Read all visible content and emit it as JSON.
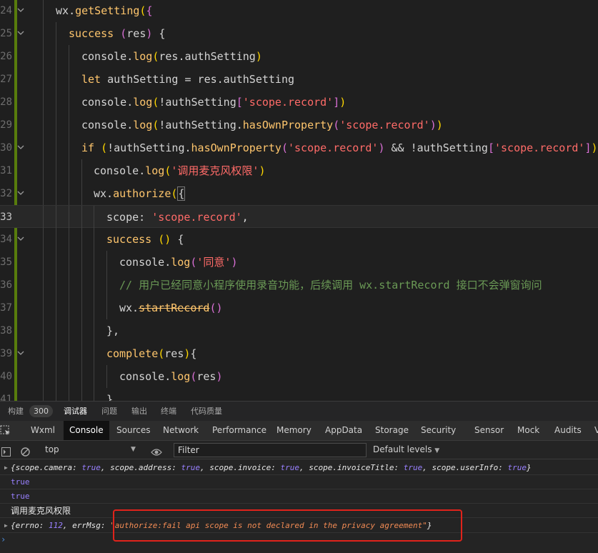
{
  "editor": {
    "lines": [
      {
        "num": "24",
        "indent": 78,
        "fold": true,
        "tokens": [
          [
            "t-obj",
            "wx"
          ],
          [
            "t-plain",
            "."
          ],
          [
            "t-fn",
            "getSetting"
          ],
          [
            "t-par",
            "("
          ],
          [
            "t-brk",
            "{"
          ]
        ]
      },
      {
        "num": "25",
        "indent": 96,
        "fold": true,
        "tokens": [
          [
            "t-kw",
            "success"
          ],
          [
            "t-plain",
            " "
          ],
          [
            "t-brk",
            "("
          ],
          [
            "t-plain",
            "res"
          ],
          [
            "t-brk",
            ")"
          ],
          [
            "t-plain",
            " {"
          ]
        ]
      },
      {
        "num": "26",
        "indent": 114,
        "fold": false,
        "tokens": [
          [
            "t-plain",
            "console."
          ],
          [
            "t-fn",
            "log"
          ],
          [
            "t-par",
            "("
          ],
          [
            "t-plain",
            "res.authSetting"
          ],
          [
            "t-par",
            ")"
          ]
        ]
      },
      {
        "num": "27",
        "indent": 114,
        "fold": false,
        "tokens": [
          [
            "t-kw",
            "let"
          ],
          [
            "t-plain",
            " authSetting = res.authSetting"
          ]
        ]
      },
      {
        "num": "28",
        "indent": 114,
        "fold": false,
        "tokens": [
          [
            "t-plain",
            "console."
          ],
          [
            "t-fn",
            "log"
          ],
          [
            "t-par",
            "("
          ],
          [
            "t-plain",
            "!authSetting"
          ],
          [
            "t-brk",
            "["
          ],
          [
            "t-str",
            "'scope.record'"
          ],
          [
            "t-brk",
            "]"
          ],
          [
            "t-par",
            ")"
          ]
        ]
      },
      {
        "num": "29",
        "indent": 114,
        "fold": false,
        "tokens": [
          [
            "t-plain",
            "console."
          ],
          [
            "t-fn",
            "log"
          ],
          [
            "t-par",
            "("
          ],
          [
            "t-plain",
            "!authSetting."
          ],
          [
            "t-fn",
            "hasOwnProperty"
          ],
          [
            "t-brk",
            "("
          ],
          [
            "t-str",
            "'scope.record'"
          ],
          [
            "t-brk",
            ")"
          ],
          [
            "t-par",
            ")"
          ]
        ]
      },
      {
        "num": "30",
        "indent": 114,
        "fold": true,
        "tokens": [
          [
            "t-kw",
            "if"
          ],
          [
            "t-plain",
            " "
          ],
          [
            "t-par",
            "("
          ],
          [
            "t-plain",
            "!authSetting."
          ],
          [
            "t-fn",
            "hasOwnProperty"
          ],
          [
            "t-brk",
            "("
          ],
          [
            "t-str",
            "'scope.record'"
          ],
          [
            "t-brk",
            ")"
          ],
          [
            "t-plain",
            " && !authSetting"
          ],
          [
            "t-brk",
            "["
          ],
          [
            "t-str",
            "'scope.record'"
          ],
          [
            "t-brk",
            "]"
          ],
          [
            "t-par",
            ")"
          ],
          [
            "t-plain",
            " {"
          ]
        ]
      },
      {
        "num": "31",
        "indent": 131,
        "fold": false,
        "tokens": [
          [
            "t-plain",
            "console."
          ],
          [
            "t-fn",
            "log"
          ],
          [
            "t-par",
            "("
          ],
          [
            "t-str",
            "'调用麦克风权限'"
          ],
          [
            "t-par",
            ")"
          ]
        ]
      },
      {
        "num": "32",
        "indent": 131,
        "fold": true,
        "tokens": [
          [
            "t-plain",
            "wx."
          ],
          [
            "t-fn",
            "authorize"
          ],
          [
            "t-par",
            "("
          ],
          [
            "t-cursor",
            "{"
          ]
        ]
      },
      {
        "num": "33",
        "indent": 149,
        "fold": false,
        "current": true,
        "tokens": [
          [
            "t-plain",
            "scope: "
          ],
          [
            "t-str",
            "'scope.record'"
          ],
          [
            "t-plain",
            ","
          ]
        ]
      },
      {
        "num": "34",
        "indent": 149,
        "fold": true,
        "tokens": [
          [
            "t-kw",
            "success"
          ],
          [
            "t-plain",
            " "
          ],
          [
            "t-par",
            "()"
          ],
          [
            "t-plain",
            " {"
          ]
        ]
      },
      {
        "num": "35",
        "indent": 167,
        "fold": false,
        "tokens": [
          [
            "t-plain",
            "console."
          ],
          [
            "t-fn",
            "log"
          ],
          [
            "t-brk",
            "("
          ],
          [
            "t-str",
            "'同意'"
          ],
          [
            "t-brk",
            ")"
          ]
        ]
      },
      {
        "num": "36",
        "indent": 167,
        "fold": false,
        "tokens": [
          [
            "t-comment",
            "// 用户已经同意小程序使用录音功能，后续调用 wx.startRecord 接口不会弹窗询问"
          ]
        ]
      },
      {
        "num": "37",
        "indent": 167,
        "fold": false,
        "tokens": [
          [
            "t-plain",
            "wx."
          ],
          [
            "t-strike",
            "startRecord"
          ],
          [
            "t-brk",
            "()"
          ]
        ]
      },
      {
        "num": "38",
        "indent": 149,
        "fold": false,
        "tokens": [
          [
            "t-plain",
            "},"
          ]
        ]
      },
      {
        "num": "39",
        "indent": 149,
        "fold": true,
        "tokens": [
          [
            "t-kw",
            "complete"
          ],
          [
            "t-par",
            "("
          ],
          [
            "t-plain",
            "res"
          ],
          [
            "t-par",
            ")"
          ],
          [
            "t-plain",
            "{"
          ]
        ]
      },
      {
        "num": "40",
        "indent": 167,
        "fold": false,
        "tokens": [
          [
            "t-plain",
            "console."
          ],
          [
            "t-fn",
            "log"
          ],
          [
            "t-brk",
            "("
          ],
          [
            "t-plain",
            "res"
          ],
          [
            "t-brk",
            ")"
          ]
        ]
      },
      {
        "num": "41",
        "indent": 149,
        "fold": false,
        "tokens": [
          [
            "t-plain",
            "}"
          ]
        ]
      }
    ]
  },
  "panel_tabs": {
    "build": "构建",
    "build_count": "300",
    "debugger": "调试器",
    "issues": "问题",
    "output": "输出",
    "terminal": "终端",
    "code_quality": "代码质量"
  },
  "devtools_tabs": [
    "Wxml",
    "Console",
    "Sources",
    "Network",
    "Performance",
    "Memory",
    "AppData",
    "Storage",
    "Security",
    "Sensor",
    "Mock",
    "Audits",
    "V"
  ],
  "toolbar": {
    "context": "top",
    "filter_placeholder": "Filter",
    "levels": "Default levels"
  },
  "console": {
    "msg1": {
      "parts": [
        [
          "c-plain",
          "{"
        ],
        [
          "c-key",
          "scope.camera"
        ],
        [
          "c-plain",
          ": "
        ],
        [
          "c-bool",
          "true"
        ],
        [
          "c-plain",
          ", "
        ],
        [
          "c-key",
          "scope.address"
        ],
        [
          "c-plain",
          ": "
        ],
        [
          "c-bool",
          "true"
        ],
        [
          "c-plain",
          ", "
        ],
        [
          "c-key",
          "scope.invoice"
        ],
        [
          "c-plain",
          ": "
        ],
        [
          "c-bool",
          "true"
        ],
        [
          "c-plain",
          ", "
        ],
        [
          "c-key",
          "scope.invoiceTitle"
        ],
        [
          "c-plain",
          ": "
        ],
        [
          "c-bool",
          "true"
        ],
        [
          "c-plain",
          ", "
        ],
        [
          "c-key",
          "scope.userInfo"
        ],
        [
          "c-plain",
          ": "
        ],
        [
          "c-bool",
          "true"
        ],
        [
          "c-plain",
          "}"
        ]
      ]
    },
    "msg2": "true",
    "msg3": "true",
    "msg4": "调用麦克风权限",
    "msg5": {
      "parts": [
        [
          "c-plain",
          "{"
        ],
        [
          "c-key",
          "errno"
        ],
        [
          "c-plain",
          ": "
        ],
        [
          "c-num",
          "112"
        ],
        [
          "c-plain",
          ", "
        ],
        [
          "c-key",
          "errMsg"
        ],
        [
          "c-plain",
          ": "
        ],
        [
          "c-str",
          "\"authorize:fail api scope is not declared in the privacy agreement\""
        ],
        [
          "c-plain",
          "}"
        ]
      ]
    },
    "prompt": "›"
  },
  "colors": {
    "highlight_box": "#e0231b",
    "git_bar": "#587c0c"
  }
}
